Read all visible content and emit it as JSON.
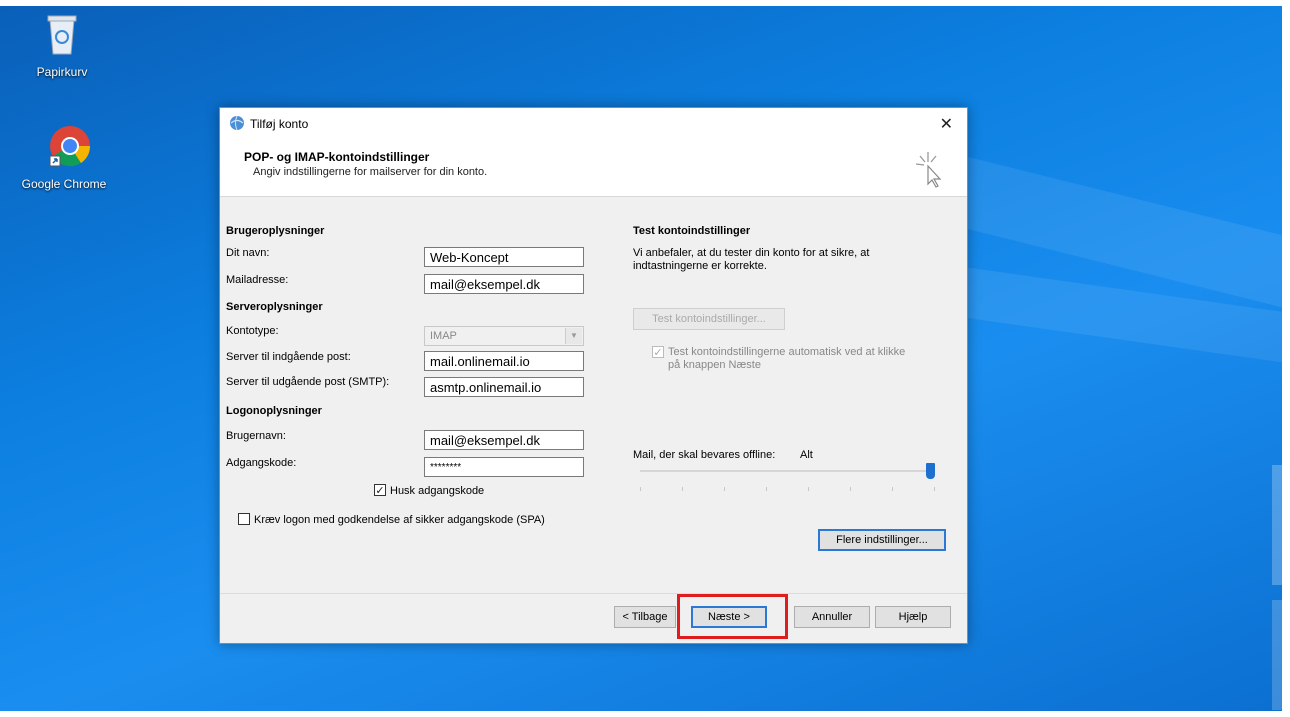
{
  "desktop": {
    "icons": [
      {
        "name": "recycle-bin",
        "label": "Papirkurv"
      },
      {
        "name": "google-chrome",
        "label": "Google Chrome"
      }
    ]
  },
  "dialog": {
    "title": "Tilføj konto",
    "header_title": "POP- og IMAP-kontoindstillinger",
    "header_subtitle": "Angiv indstillingerne for mailserver for din konto.",
    "user_section": "Brugeroplysninger",
    "name_label": "Dit navn:",
    "name_value": "Web-Koncept",
    "email_label": "Mailadresse:",
    "email_value": "mail@eksempel.dk",
    "server_section": "Serveroplysninger",
    "account_type_label": "Kontotype:",
    "account_type_value": "IMAP",
    "incoming_label": "Server til indgående post:",
    "incoming_value": "mail.onlinemail.io",
    "outgoing_label": "Server til udgående post (SMTP):",
    "outgoing_value": "asmtp.onlinemail.io",
    "logon_section": "Logonoplysninger",
    "username_label": "Brugernavn:",
    "username_value": "mail@eksempel.dk",
    "password_label": "Adgangskode:",
    "password_value": "********",
    "remember_password_label": "Husk adgangskode",
    "remember_password_checked": true,
    "spa_label": "Kræv logon med godkendelse af sikker adgangskode (SPA)",
    "spa_checked": false,
    "test_section": "Test kontoindstillinger",
    "test_description": "Vi anbefaler, at du tester din konto for at sikre, at indtastningerne er korrekte.",
    "test_button": "Test kontoindstillinger...",
    "auto_test_label": "Test kontoindstillingerne automatisk ved at klikke på knappen Næste",
    "auto_test_checked": true,
    "offline_label": "Mail, der skal bevares offline:",
    "offline_value": "Alt",
    "offline_slider_fraction": 1.0,
    "more_settings_button": "Flere indstillinger...",
    "back_button": "< Tilbage",
    "next_button": "Næste >",
    "cancel_button": "Annuller",
    "help_button": "Hjælp"
  },
  "colors": {
    "desktop_blue": "#0b78d4",
    "highlight": "#e01d1d",
    "slider_blue": "#1f6fd1"
  }
}
